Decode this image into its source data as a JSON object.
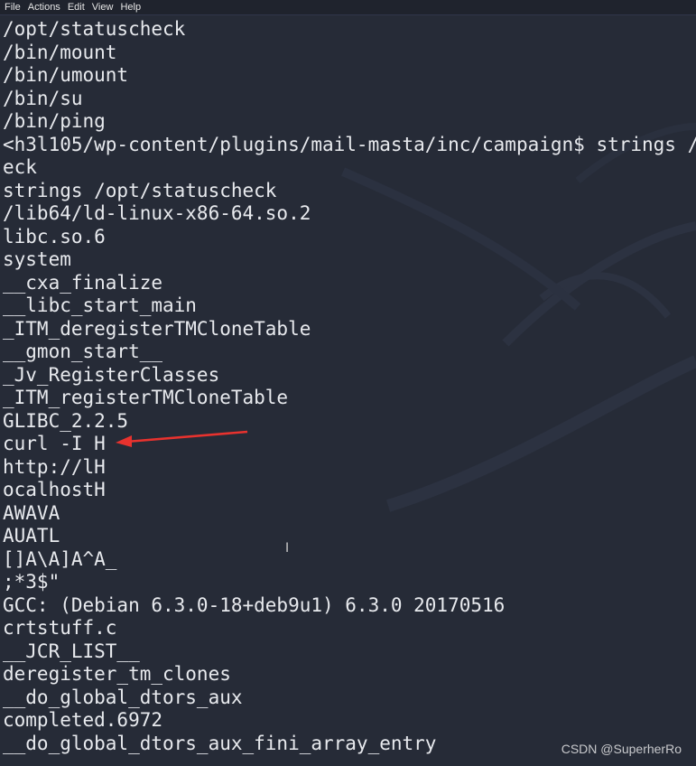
{
  "menu": [
    "File",
    "Actions",
    "Edit",
    "View",
    "Help"
  ],
  "terminal_lines": [
    "/opt/statuscheck",
    "/bin/mount",
    "/bin/umount",
    "/bin/su",
    "/bin/ping",
    "<h3l105/wp-content/plugins/mail-masta/inc/campaign$ strings /",
    "eck",
    "strings /opt/statuscheck",
    "/lib64/ld-linux-x86-64.so.2",
    "libc.so.6",
    "system",
    "__cxa_finalize",
    "__libc_start_main",
    "_ITM_deregisterTMCloneTable",
    "__gmon_start__",
    "_Jv_RegisterClasses",
    "_ITM_registerTMCloneTable",
    "GLIBC_2.2.5",
    "curl -I H",
    "http://lH",
    "ocalhostH",
    "AWAVA",
    "AUATL",
    "[]A\\A]A^A_",
    ";*3$\"",
    "GCC: (Debian 6.3.0-18+deb9u1) 6.3.0 20170516",
    "crtstuff.c",
    "__JCR_LIST__",
    "deregister_tm_clones",
    "__do_global_dtors_aux",
    "completed.6972",
    "__do_global_dtors_aux_fini_array_entry"
  ],
  "annotation": {
    "color": "#e8322e",
    "target_line": "curl -I H"
  },
  "cursor_icon": "text-cursor-icon",
  "watermark": "CSDN @SuperherRo"
}
